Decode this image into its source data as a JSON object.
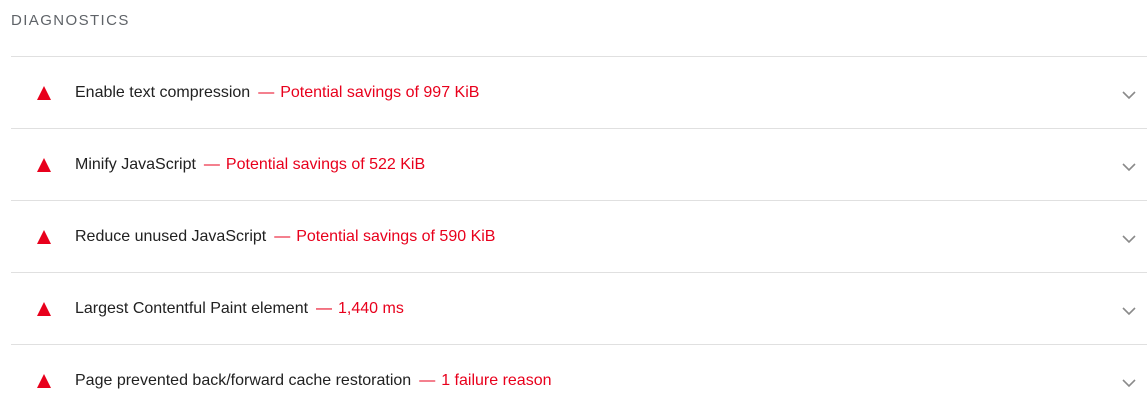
{
  "section": {
    "title": "DIAGNOSTICS"
  },
  "audits": [
    {
      "title": "Enable text compression",
      "separator": "—",
      "value": "Potential savings of 997 KiB"
    },
    {
      "title": "Minify JavaScript",
      "separator": "—",
      "value": "Potential savings of 522 KiB"
    },
    {
      "title": "Reduce unused JavaScript",
      "separator": "—",
      "value": "Potential savings of 590 KiB"
    },
    {
      "title": "Largest Contentful Paint element",
      "separator": "—",
      "value": "1,440 ms"
    },
    {
      "title": "Page prevented back/forward cache restoration",
      "separator": "—",
      "value": "1 failure reason"
    }
  ],
  "icons": {
    "status": "warning-triangle-icon",
    "expand": "chevron-down-icon"
  },
  "colors": {
    "fail": "#e8001c",
    "text": "#212121",
    "muted": "#5f6368",
    "divider": "#e0e0e0"
  }
}
